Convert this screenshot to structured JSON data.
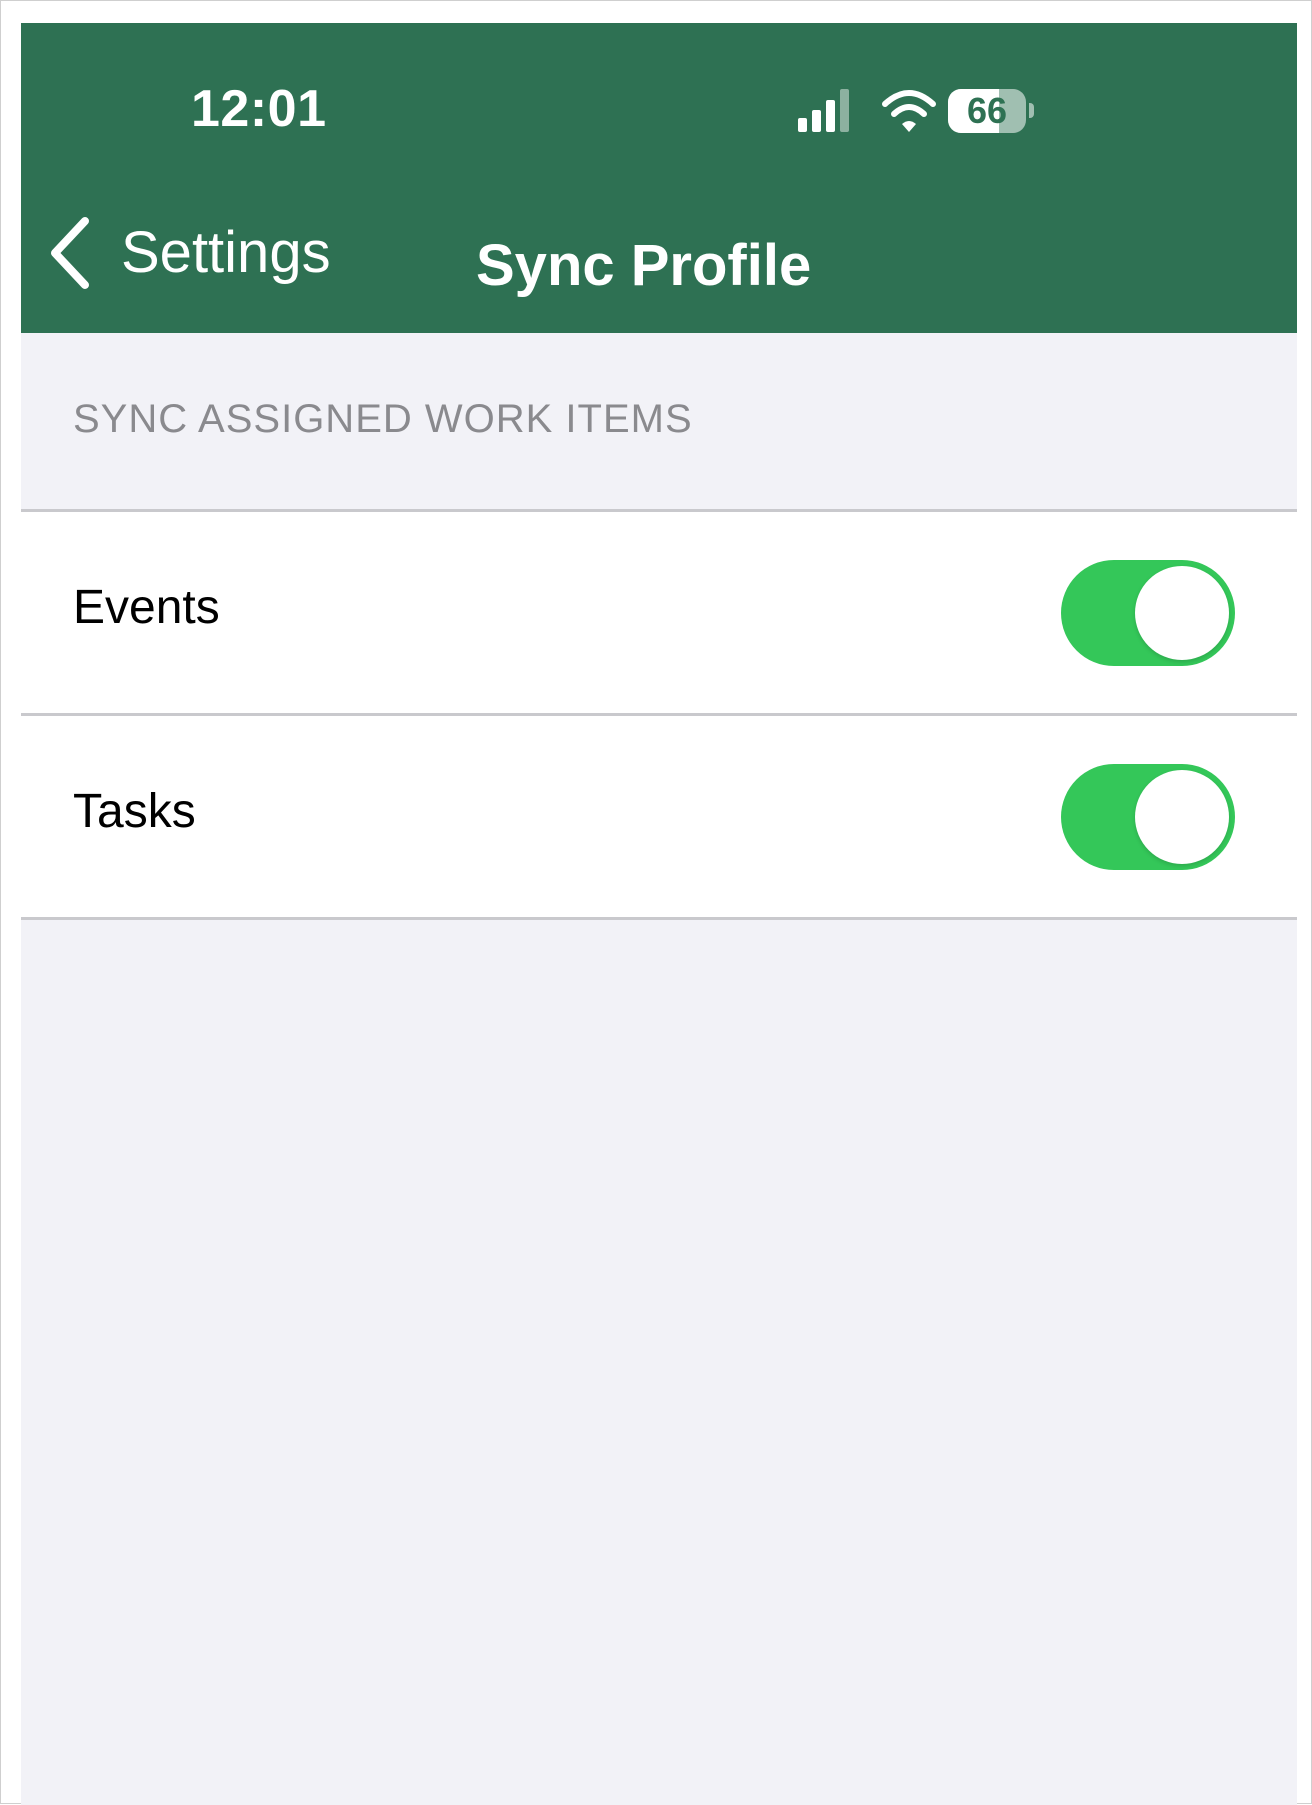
{
  "status_bar": {
    "time": "12:01",
    "battery_level": "66",
    "battery_fraction": 0.66,
    "icons": [
      "signal-icon",
      "wifi-icon",
      "battery-icon"
    ]
  },
  "nav": {
    "back_label": "Settings",
    "back_icon": "chevron-left-icon",
    "title": "Sync Profile"
  },
  "section": {
    "header": "SYNC ASSIGNED WORK ITEMS",
    "rows": [
      {
        "label": "Events",
        "enabled": true
      },
      {
        "label": "Tasks",
        "enabled": true
      }
    ]
  },
  "colors": {
    "header_background": "#2e7153",
    "toggle_on": "#34c759",
    "screen_background": "#f2f2f7"
  }
}
